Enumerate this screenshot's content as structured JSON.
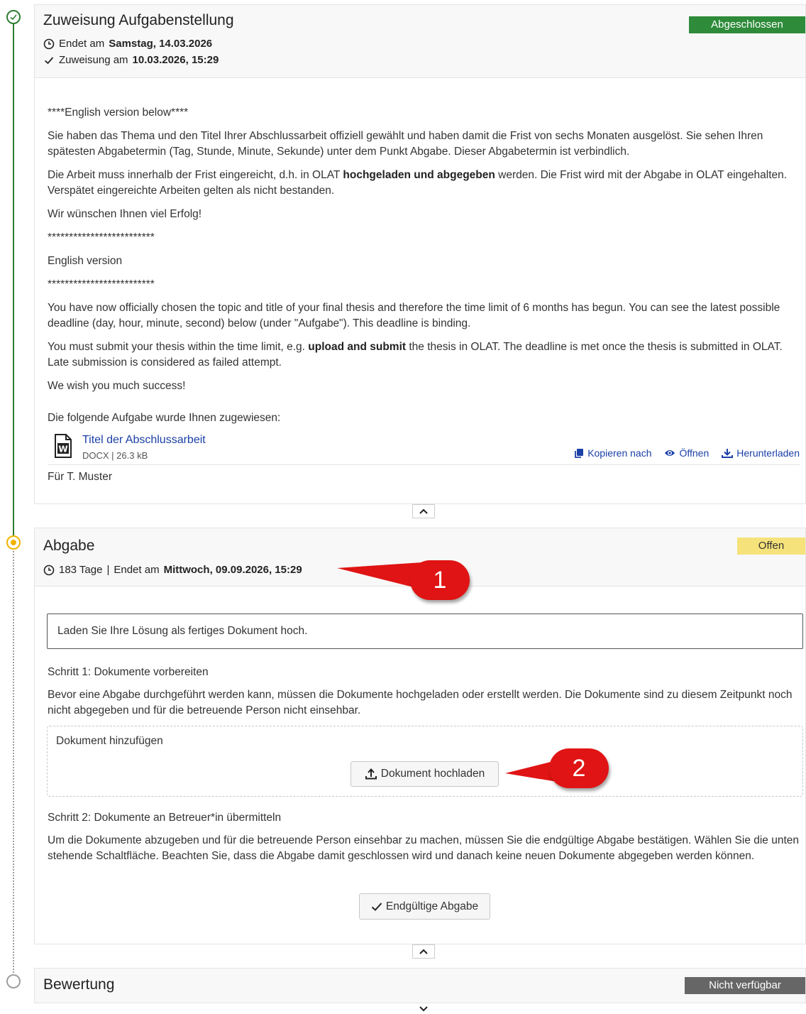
{
  "colors": {
    "done": "#2e8b3a",
    "open": "#f6e27a",
    "not_available": "#666666",
    "link": "#1a3fa6",
    "callout": "#e01414"
  },
  "assignment": {
    "title": "Zuweisung Aufgabenstellung",
    "status": "Abgeschlossen",
    "end_prefix": "Endet am",
    "end_value": "Samstag, 14.03.2026",
    "assigned_prefix": "Zuweisung am",
    "assigned_value": "10.03.2026, 15:29",
    "body": {
      "english_below": "****English version below****",
      "de_p1": "Sie haben das Thema und den Titel Ihrer Abschlussarbeit offiziell gewählt und haben damit die Frist von sechs Monaten ausgelöst. Sie sehen Ihren spätesten Abgabetermin (Tag, Stunde, Minute, Sekunde) unter dem Punkt Abgabe. Dieser Abgabetermin ist verbindlich.",
      "de_p2_a": "Die Arbeit muss innerhalb der Frist eingereicht, d.h. in OLAT ",
      "de_p2_b": "hochgeladen und abgegeben",
      "de_p2_c": " werden. Die Frist wird mit der Abgabe in OLAT eingehalten. Verspätet eingereichte Arbeiten gelten als nicht bestanden.",
      "de_p3": "Wir wünschen Ihnen viel Erfolg!",
      "stars": "*************************",
      "english_version": "English version",
      "en_p1": "You have now officially chosen the topic and title of your final thesis and therefore the time limit of 6 months has begun. You can see the latest possible deadline (day, hour, minute, second) below (under \"Aufgabe\"). This deadline is binding.",
      "en_p2_a": "You must submit your thesis within the time limit, e.g. ",
      "en_p2_b": "upload and submit",
      "en_p2_c": " the thesis in OLAT. The deadline is met once the thesis is submitted in OLAT. Late submission is considered as failed attempt.",
      "en_p3": "We wish you much success!",
      "assigned_intro": "Die folgende Aufgabe wurde Ihnen zugewiesen:"
    },
    "file": {
      "name": "Titel der Abschlussarbeit",
      "meta": "DOCX | 26.3 kB",
      "icon": "word-document-icon",
      "icon_letter": "W",
      "actions": {
        "copy": "Kopieren nach",
        "open": "Öffnen",
        "download": "Herunterladen"
      }
    },
    "for_label": "Für T. Muster"
  },
  "submission": {
    "title": "Abgabe",
    "status": "Offen",
    "days": "183 Tage",
    "sep": "|",
    "end_prefix": "Endet am",
    "end_value": "Mittwoch, 09.09.2026, 15:29",
    "info": "Laden Sie Ihre Lösung als fertiges Dokument hoch.",
    "step1_title": "Schritt 1: Dokumente vorbereiten",
    "step1_text": "Bevor eine Abgabe durchgeführt werden kann, müssen die Dokumente hochgeladen oder erstellt werden. Die Dokumente sind zu diesem Zeitpunkt noch nicht abgegeben und für die betreuende Person nicht einsehbar.",
    "add_document_label": "Dokument hinzufügen",
    "upload_button": "Dokument hochladen",
    "step2_title": "Schritt 2: Dokumente an Betreuer*in übermitteln",
    "step2_text": "Um die Dokumente abzugeben und für die betreuende Person einsehbar zu machen, müssen Sie die endgültige Abgabe bestätigen. Wählen Sie die unten stehende Schaltfläche. Beachten Sie, dass die Abgabe damit geschlossen wird und danach keine neuen Dokumente abgegeben werden können.",
    "final_button": "Endgültige Abgabe"
  },
  "assessment": {
    "title": "Bewertung",
    "status": "Nicht verfügbar"
  },
  "callouts": {
    "one": "1",
    "two": "2"
  }
}
